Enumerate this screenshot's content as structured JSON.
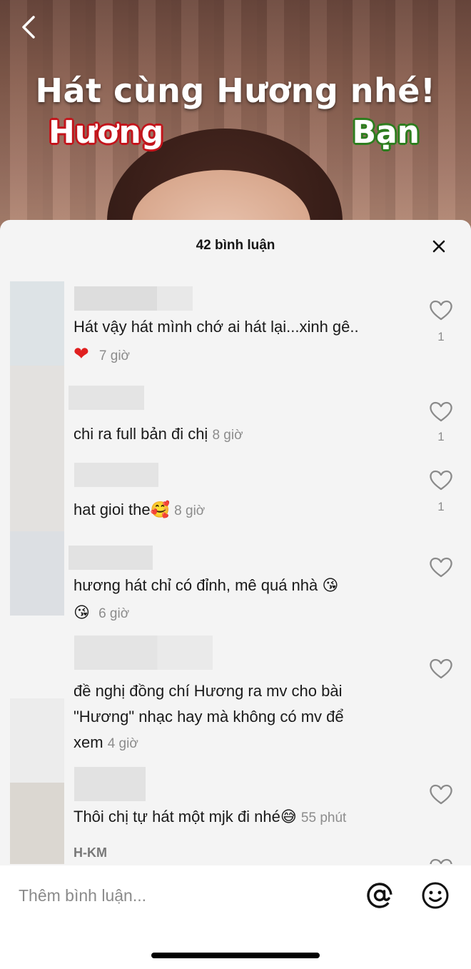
{
  "video": {
    "title": "Hát cùng Hương nhé!",
    "label_left": "Hương",
    "label_right": "Bạn"
  },
  "sheet": {
    "title": "42 bình luận"
  },
  "comments": [
    {
      "text": "Hát vậy hát mình chớ ai hát lại...xinh gê..",
      "trailing_emoji": "❤️",
      "time": "7 giờ",
      "likes": "1",
      "icon": "heart-outline-icon"
    },
    {
      "text": "chi ra full bản đi chị",
      "time": "8 giờ",
      "likes": "1",
      "icon": "heart-outline-icon"
    },
    {
      "text": "hat gioi the",
      "trailing_emoji": "🥰",
      "time": "8 giờ",
      "likes": "1",
      "icon": "heart-outline-icon"
    },
    {
      "text": "hương hát chỉ có đỉnh, mê quá nhà",
      "trailing_emoji": "😘",
      "lead_emoji_2": "😘",
      "time": "6 giờ",
      "icon": "heart-outline-icon"
    },
    {
      "text_line1": "đề nghị đồng chí Hương ra mv cho bài",
      "text_line2": "\"Hương\" nhạc hay mà không có mv để",
      "text_line3": "xem",
      "time": "4 giờ",
      "icon": "heart-outline-icon"
    },
    {
      "text": "Thôi chị tự hát một mjk đi nhé",
      "trailing_emoji": "😅",
      "time": "55 phút",
      "icon": "heart-outline-icon"
    },
    {
      "username": "H-KM"
    }
  ],
  "input": {
    "placeholder": "Thêm bình luận..."
  },
  "colors": {
    "sheet_bg": "#f4f4f4",
    "label_left_outline": "#c3141b",
    "label_right_outline": "#2d7d1e",
    "time_gray": "#8c8c8c"
  }
}
